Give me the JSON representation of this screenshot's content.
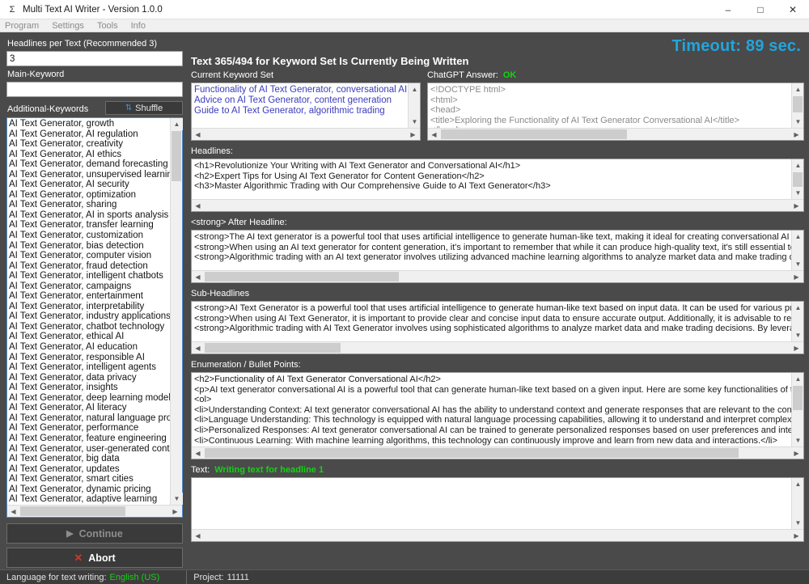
{
  "window": {
    "title": "Multi Text AI Writer - Version 1.0.0",
    "app_icon": "sigma-icon",
    "minimize": "–",
    "maximize": "☐",
    "close": "✕"
  },
  "menubar": [
    "Program",
    "Settings",
    "Tools",
    "Info"
  ],
  "left_panel": {
    "headlines_label": "Headlines per Text (Recommended 3)",
    "headlines_value": "3",
    "main_keyword_label": "Main-Keyword",
    "main_keyword_value": "",
    "main_keyword_placeholder": "",
    "additional_keywords_label": "Additional-Keywords",
    "shuffle_label": "Shuffle",
    "shuffle_icon": "⇅",
    "keywords": [
      "AI Text Generator, growth",
      "AI Text Generator, AI regulation",
      "AI Text Generator, creativity",
      "AI Text Generator, AI ethics",
      "AI Text Generator, demand forecasting",
      "AI Text Generator, unsupervised learning",
      "AI Text Generator, AI security",
      "AI Text Generator, optimization",
      "AI Text Generator, sharing",
      "AI Text Generator, AI in sports analysis",
      "AI Text Generator, transfer learning",
      "AI Text Generator, customization",
      "AI Text Generator, bias detection",
      "AI Text Generator, computer vision",
      "AI Text Generator, fraud detection",
      "AI Text Generator, intelligent chatbots",
      "AI Text Generator, campaigns",
      "AI Text Generator, entertainment",
      "AI Text Generator, interpretability",
      "AI Text Generator, industry applications",
      "AI Text Generator, chatbot technology",
      "AI Text Generator, ethical AI",
      "AI Text Generator, AI education",
      "AI Text Generator, responsible AI",
      "AI Text Generator, intelligent agents",
      "AI Text Generator, data privacy",
      "AI Text Generator, insights",
      "AI Text Generator, deep learning models",
      "AI Text Generator, AI literacy",
      "AI Text Generator, natural language proces",
      "AI Text Generator, performance",
      "AI Text Generator, feature engineering",
      "AI Text Generator, user-generated content",
      "AI Text Generator, big data",
      "AI Text Generator, updates",
      "AI Text Generator, smart cities",
      "AI Text Generator, dynamic pricing",
      "AI Text Generator, adaptive learning"
    ],
    "continue_label": "Continue",
    "continue_icon": "▶",
    "continue_enabled": false,
    "abort_label": "Abort",
    "abort_icon": "✕"
  },
  "right_panel": {
    "timeout_text": "Timeout: 89 sec.",
    "timeout_color": "#22a5dd",
    "page_title": "Text 365/494 for Keyword Set Is Currently Being Written",
    "current_keyword_set_label": "Current Keyword Set",
    "current_keyword_set_lines": [
      "Functionality of AI Text Generator, conversational AI",
      "Advice on AI Text Generator, content generation",
      "Guide to AI Text Generator, algorithmic trading"
    ],
    "chatgpt_answer_label": "ChatGPT Answer:",
    "chatgpt_answer_status": "OK",
    "chatgpt_answer_status_color": "#14d314",
    "chatgpt_answer_lines": [
      "<!DOCTYPE html>",
      "<html>",
      "<head>",
      "<title>Exploring the Functionality of AI Text Generator Conversational AI</title>",
      "</head>"
    ],
    "headlines_label": "Headlines:",
    "headlines_lines": [
      "<h1>Revolutionize Your Writing with AI Text Generator and Conversational AI</h1>",
      "<h2>Expert Tips for Using AI Text Generator for Content Generation</h2>",
      "<h3>Master Algorithmic Trading with Our Comprehensive Guide to AI Text Generator</h3>"
    ],
    "after_headline_label": "<strong> After Headline:",
    "after_headline_lines": [
      "<strong>The AI text generator is a powerful tool that uses artificial intelligence to generate human-like text, making it ideal for creating conversational AI applications",
      "<strong>When using an AI text generator for content generation, it's important to remember that while it can produce high-quality text, it's still essential to review and",
      "<strong>Algorithmic trading with an AI text generator involves utilizing advanced machine learning algorithms to analyze market data and make trading decisions."
    ],
    "sub_headlines_label": "Sub-Headlines",
    "sub_headlines_lines": [
      "<strong>AI Text Generator is a powerful tool that uses artificial intelligence to generate human-like text based on input data. It can be used for various purposes suc",
      "<strong>When using AI Text Generator, it is important to provide clear and concise input data to ensure accurate output. Additionally, it is advisable to review and e",
      "<strong>Algorithmic trading with AI Text Generator involves using sophisticated algorithms to analyze market data and make trading decisions. By leveraging AI T"
    ],
    "enumeration_label": "Enumeration / Bullet Points:",
    "enumeration_lines": [
      "<h2>Functionality of AI Text Generator Conversational AI</h2>",
      "<p>AI text generator conversational AI is a powerful tool that can generate human-like text based on a given input. Here are some key functionalities of this technolo",
      "<ol>",
      "<li>Understanding Context: AI text generator conversational AI has the ability to understand context and generate responses that are relevant to the conversation.<",
      "<li>Language Understanding: This technology is equipped with natural language processing capabilities, allowing it to understand and interpret complex language",
      "<li>Personalized Responses: AI text generator conversational AI can be trained to generate personalized responses based on user preferences and interactions.",
      "<li>Continuous Learning: With machine learning algorithms, this technology can continuously improve and learn from new data and interactions.</li>"
    ],
    "text_label": "Text:",
    "text_status": "Writing text for headline 1",
    "text_status_color": "#14d314",
    "text_lines": []
  },
  "statusbar": {
    "language_label": "Language for text writing:",
    "language_value": "English (US)",
    "project_label": "Project:",
    "project_value": "11111"
  }
}
